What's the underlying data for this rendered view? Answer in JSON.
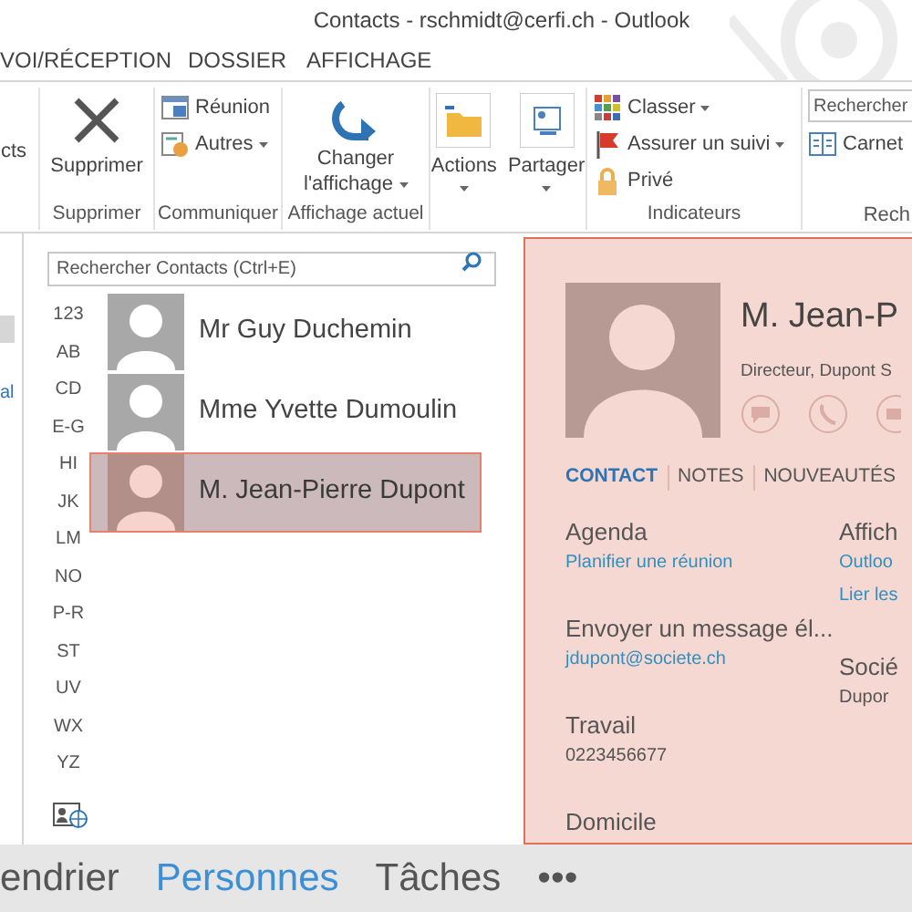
{
  "window": {
    "title": "Contacts - rschmidt@cerfi.ch - Outlook"
  },
  "ribbon_tabs": [
    {
      "label": "VOI/RÉCEPTION",
      "selected": false
    },
    {
      "label": "DOSSIER",
      "selected": false
    },
    {
      "label": "AFFICHAGE",
      "selected": false
    }
  ],
  "ribbon": {
    "groups": [
      {
        "buttons": [
          {
            "label": "cts",
            "kind": "large"
          }
        ]
      },
      {
        "label": "Supprimer",
        "buttons": [
          {
            "label": "Supprimer",
            "kind": "large"
          }
        ]
      },
      {
        "label": "Communiquer",
        "buttons": [
          {
            "label": "Réunion",
            "kind": "small"
          },
          {
            "label": "Autres",
            "kind": "small",
            "dropdown": true
          }
        ]
      },
      {
        "label": "Affichage actuel",
        "buttons": [
          {
            "label": "Changer l'affichage",
            "kind": "large",
            "dropdown": true
          }
        ]
      },
      {
        "buttons": [
          {
            "label": "Actions",
            "kind": "large",
            "dropdown": true
          },
          {
            "label": "Partager",
            "kind": "large",
            "dropdown": true
          }
        ]
      },
      {
        "label": "Indicateurs",
        "buttons": [
          {
            "label": "Classer",
            "kind": "small",
            "dropdown": true
          },
          {
            "label": "Assurer un suivi",
            "kind": "small",
            "dropdown": true
          },
          {
            "label": "Privé",
            "kind": "small"
          }
        ]
      },
      {
        "label": "Rech",
        "search_placeholder": "Rechercher",
        "buttons": [
          {
            "label": "Carnet",
            "kind": "small"
          }
        ]
      }
    ]
  },
  "folder_pane": {
    "items": [
      {
        "selected": true
      },
      {
        "label": "al",
        "selected": false
      }
    ]
  },
  "contacts": {
    "search_placeholder": "Rechercher Contacts (Ctrl+E)",
    "index": [
      "123",
      "AB",
      "CD",
      "E-G",
      "HI",
      "JK",
      "LM",
      "NO",
      "P-R",
      "ST",
      "UV",
      "WX",
      "YZ"
    ],
    "items": [
      {
        "name": "Mr Guy Duchemin",
        "selected": false
      },
      {
        "name": "Mme Yvette Dumoulin",
        "selected": false
      },
      {
        "name": "M. Jean-Pierre Dupont",
        "selected": true
      }
    ]
  },
  "card": {
    "name": "M. Jean-P",
    "subtitle": "Directeur, Dupont S",
    "tabs": [
      {
        "label": "CONTACT",
        "selected": true
      },
      {
        "label": "NOTES",
        "selected": false
      },
      {
        "label": "NOUVEAUTÉS",
        "selected": false
      }
    ],
    "left_fields": [
      {
        "label": "Agenda",
        "value": "Planifier une réunion",
        "kind": "link"
      },
      {
        "label": "Envoyer un message él...",
        "value": "jdupont@societe.ch",
        "kind": "link"
      },
      {
        "label": "Travail",
        "value": "0223456677",
        "kind": "text"
      },
      {
        "label": "Domicile"
      }
    ],
    "right_fields": [
      {
        "label": "Affich",
        "value": "Outloo",
        "kind": "link"
      },
      {
        "value": "Lier les",
        "kind": "link"
      },
      {
        "label": "Socié",
        "value": "Dupor",
        "kind": "text"
      }
    ]
  },
  "bottom_nav": [
    {
      "label": "endrier",
      "selected": false
    },
    {
      "label": "Personnes",
      "selected": true
    },
    {
      "label": "Tâches",
      "selected": false
    },
    {
      "label": "•••",
      "selected": false
    }
  ]
}
